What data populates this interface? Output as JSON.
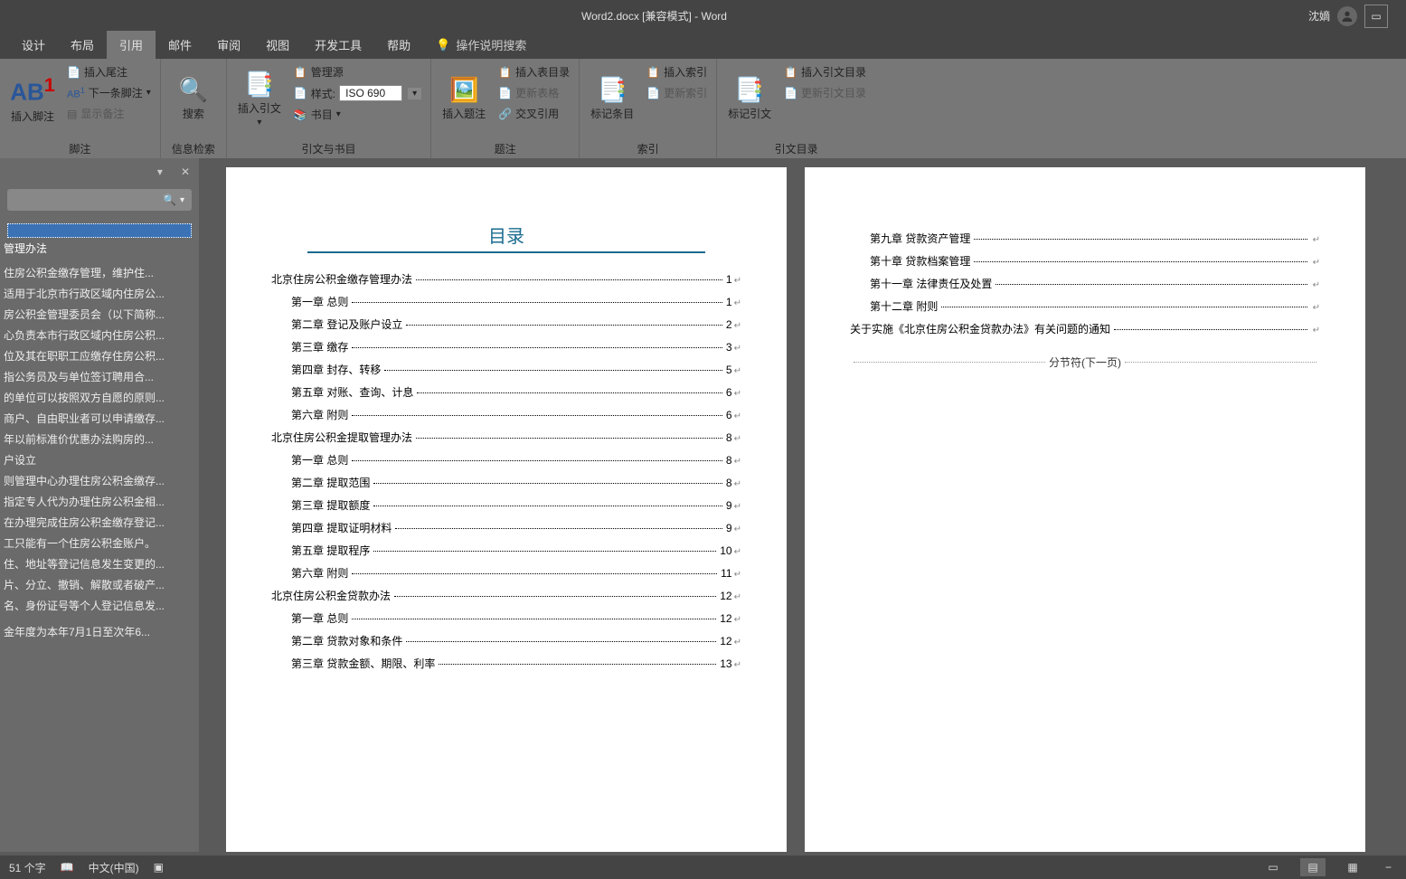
{
  "title": "Word2.docx [兼容模式] - Word",
  "user_name": "沈嫡",
  "tabs": [
    "设计",
    "布局",
    "引用",
    "邮件",
    "审阅",
    "视图",
    "开发工具",
    "帮助"
  ],
  "active_tab": "引用",
  "tell_me": "操作说明搜索",
  "ribbon": {
    "footnote": {
      "big": "插入脚注",
      "endnote": "插入尾注",
      "next": "下一条脚注",
      "show": "显示备注",
      "label": "脚注"
    },
    "research": {
      "big": "搜索",
      "label": "信息检索"
    },
    "citation": {
      "big": "插入引文",
      "manage": "管理源",
      "style_lbl": "样式:",
      "style_val": "ISO 690",
      "biblio": "书目",
      "label": "引文与书目"
    },
    "caption": {
      "big": "插入题注",
      "figtable": "插入表目录",
      "update": "更新表格",
      "xref": "交叉引用",
      "label": "题注"
    },
    "index": {
      "big": "标记条目",
      "insert": "插入索引",
      "update": "更新索引",
      "label": "索引"
    },
    "toa": {
      "big": "标记引文",
      "insert": "插入引文目录",
      "update": "更新引文目录",
      "label": "引文目录"
    }
  },
  "nav": {
    "heading": "管理办法",
    "items": [
      "住房公积金缴存管理，维护住...",
      "适用于北京市行政区域内住房公...",
      "房公积金管理委员会（以下简称...",
      "心负责本市行政区域内住房公积...",
      "位及其在职职工应缴存住房公积...",
      "指公务员及与单位签订聘用合...",
      "的单位可以按照双方自愿的原则...",
      "商户、自由职业者可以申请缴存...",
      "年以前标准价优惠办法购房的...",
      "户设立",
      "则管理中心办理住房公积金缴存...",
      "指定专人代为办理住房公积金相...",
      "在办理完成住房公积金缴存登记...",
      "工只能有一个住房公积金账户。",
      "住、地址等登记信息发生变更的...",
      "片、分立、撤销、解散或者破产...",
      "名、身份证号等个人登记信息发...",
      "",
      "金年度为本年7月1日至次年6..."
    ]
  },
  "toc_title": "目录",
  "toc1": [
    {
      "l": 1,
      "t": "北京住房公积金缴存管理办法",
      "p": "1"
    },
    {
      "l": 2,
      "t": "第一章 总则",
      "p": "1"
    },
    {
      "l": 2,
      "t": "第二章 登记及账户设立",
      "p": "2"
    },
    {
      "l": 2,
      "t": "第三章 缴存",
      "p": "3"
    },
    {
      "l": 2,
      "t": "第四章 封存、转移",
      "p": "5"
    },
    {
      "l": 2,
      "t": "第五章 对账、查询、计息",
      "p": "6"
    },
    {
      "l": 2,
      "t": "第六章 附则",
      "p": "6"
    },
    {
      "l": 1,
      "t": "北京住房公积金提取管理办法",
      "p": "8"
    },
    {
      "l": 2,
      "t": "第一章 总则",
      "p": "8"
    },
    {
      "l": 2,
      "t": "第二章 提取范围",
      "p": "8"
    },
    {
      "l": 2,
      "t": "第三章 提取额度",
      "p": "9"
    },
    {
      "l": 2,
      "t": "第四章 提取证明材料",
      "p": "9"
    },
    {
      "l": 2,
      "t": "第五章 提取程序",
      "p": "10"
    },
    {
      "l": 2,
      "t": "第六章 附则",
      "p": "11"
    },
    {
      "l": 1,
      "t": "北京住房公积金贷款办法",
      "p": "12"
    },
    {
      "l": 2,
      "t": "第一章 总则",
      "p": "12"
    },
    {
      "l": 2,
      "t": "第二章 贷款对象和条件",
      "p": "12"
    },
    {
      "l": 2,
      "t": "第三章 贷款金额、期限、利率",
      "p": "13"
    }
  ],
  "toc2": [
    {
      "l": 2,
      "t": "第九章 贷款资产管理",
      "p": ""
    },
    {
      "l": 2,
      "t": "第十章 贷款档案管理",
      "p": ""
    },
    {
      "l": 2,
      "t": "第十一章 法律责任及处置",
      "p": ""
    },
    {
      "l": 2,
      "t": "第十二章 附则",
      "p": ""
    },
    {
      "l": 1,
      "t": "关于实施《北京住房公积金贷款办法》有关问题的通知",
      "p": ""
    }
  ],
  "section_break": "分节符(下一页)",
  "status": {
    "words": "51 个字",
    "lang": "中文(中国)"
  }
}
